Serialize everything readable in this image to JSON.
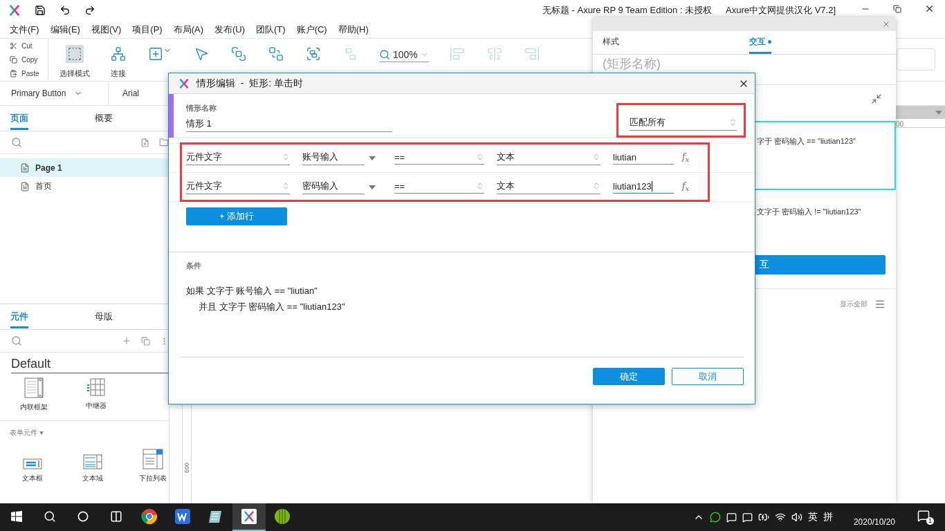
{
  "app": {
    "title": "无标题 - Axure RP 9 Team Edition : 未授权",
    "title_suffix": "Axure中文网提供汉化 V7.2]"
  },
  "menu": [
    "文件(F)",
    "编辑(E)",
    "视图(V)",
    "项目(P)",
    "布局(A)",
    "发布(U)",
    "团队(T)",
    "账户(C)",
    "帮助(H)"
  ],
  "clipboard": [
    {
      "kind": "cut",
      "label": "Cut"
    },
    {
      "kind": "copy",
      "label": "Copy"
    },
    {
      "kind": "paste",
      "label": "Paste"
    }
  ],
  "tools": [
    {
      "kind": "select",
      "label": "选择模式",
      "selected": true,
      "disabled": false
    },
    {
      "kind": "connect",
      "label": "连接",
      "selected": false,
      "disabled": false
    },
    {
      "kind": "insert",
      "selected": false,
      "disabled": false
    },
    {
      "kind": "point",
      "selected": false,
      "disabled": false
    },
    {
      "kind": "top",
      "selected": false,
      "disabled": false
    },
    {
      "kind": "bottom",
      "selected": false,
      "disabled": false
    },
    {
      "kind": "group",
      "selected": false,
      "disabled": false
    },
    {
      "kind": "ungroup",
      "selected": false,
      "disabled": true
    },
    {
      "kind": "zoom",
      "value": "100%"
    },
    {
      "kind": "align-left",
      "selected": false,
      "disabled": true
    },
    {
      "kind": "align-center",
      "selected": false,
      "disabled": true
    },
    {
      "kind": "align-right",
      "selected": false,
      "disabled": true
    }
  ],
  "style_bar": {
    "style": "Primary Button",
    "font": "Arial"
  },
  "pages_panel": {
    "tabs": [
      {
        "label": "页面",
        "selected": true
      },
      {
        "label": "概要",
        "selected": false
      }
    ],
    "pages": [
      {
        "name": "Page 1",
        "selected": true
      },
      {
        "name": "首页",
        "selected": false
      }
    ]
  },
  "widgets_panel": {
    "tabs": [
      {
        "label": "元件",
        "selected": true
      },
      {
        "label": "母版",
        "selected": false
      }
    ],
    "library": "Default",
    "widgets": [
      {
        "kind": "inline-frame",
        "label": "内联框架"
      },
      {
        "kind": "repeater",
        "label": "中继器"
      }
    ],
    "section": "表单元件",
    "section_expanded": true,
    "form_widgets": [
      {
        "kind": "text-field",
        "label": "文本框"
      },
      {
        "kind": "text-area",
        "label": "文本域"
      },
      {
        "kind": "dropdown",
        "label": "下拉列表"
      }
    ]
  },
  "canvas": {
    "ruler_label": "600"
  },
  "inspector": {
    "ruler_label": "00"
  },
  "interaction_panel": {
    "tabs": [
      {
        "label": "样式",
        "selected": false,
        "modified": false
      },
      {
        "label": "交互",
        "selected": true,
        "modified": true
      }
    ],
    "name_placeholder": "(矩形名称)",
    "cases": [
      {
        "text": "字于 密码输入 == \"liutian123\"",
        "selected": true
      },
      {
        "text": "文字于 密码输入 != \"liutian123\"",
        "selected": false
      }
    ],
    "button": "互",
    "show_all": "显示全部"
  },
  "dialog": {
    "title": "情形编辑  -  矩形: 单击时",
    "name_label": "情形名称",
    "name_value": "情形 1",
    "match": "匹配所有",
    "rows": [
      {
        "target_type": "元件文字",
        "target": "账号输入",
        "operator": "==",
        "value_type": "文本",
        "value": "liutian",
        "function": "f$_{x}$",
        "focused": false
      },
      {
        "target_type": "元件文字",
        "target": "密码输入",
        "operator": "==",
        "value_type": "文本",
        "value": "liutian123",
        "function": "f$_{x}$",
        "focused": true
      }
    ],
    "add_row": "+ 添加行",
    "conditions_label": "条件",
    "summary": [
      {
        "text": "如果 文字于 账号输入 == \"liutian\"",
        "indented": false
      },
      {
        "text": "并且 文字于 密码输入 == \"liutian123\"",
        "indented": true
      }
    ],
    "buttons": [
      {
        "label": "确定",
        "primary": true
      },
      {
        "label": "取消",
        "primary": false
      }
    ]
  },
  "taskbar": {
    "apps": [
      {
        "kind": "chrome",
        "active": false
      },
      {
        "kind": "wps",
        "active": false
      },
      {
        "kind": "notepad",
        "active": false
      },
      {
        "kind": "axure",
        "active": true
      },
      {
        "kind": "bamboo",
        "active": false
      }
    ],
    "ime": [
      "英",
      "拼"
    ],
    "date": "2020/10/20",
    "notifications": "1"
  }
}
